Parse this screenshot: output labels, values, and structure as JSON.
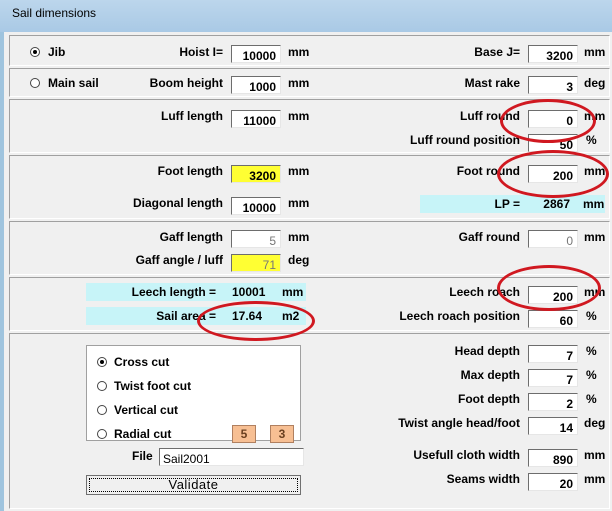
{
  "window": {
    "title": "Sail dimensions"
  },
  "sail_type": {
    "jib_label": "Jib",
    "main_label": "Main sail",
    "selected": "jib"
  },
  "fields": {
    "hoist": {
      "label": "Hoist I=",
      "value": "10000",
      "unit": "mm"
    },
    "base": {
      "label": "Base J=",
      "value": "3200",
      "unit": "mm"
    },
    "boom_height": {
      "label": "Boom height",
      "value": "1000",
      "unit": "mm"
    },
    "mast_rake": {
      "label": "Mast rake",
      "value": "3",
      "unit": "deg"
    },
    "luff_length": {
      "label": "Luff length",
      "value": "11000",
      "unit": "mm"
    },
    "luff_round": {
      "label": "Luff round",
      "value": "0",
      "unit": "mm"
    },
    "luff_round_position": {
      "label": "Luff round position",
      "value": "50",
      "unit": "%"
    },
    "foot_length": {
      "label": "Foot length",
      "value": "3200",
      "unit": "mm"
    },
    "foot_round": {
      "label": "Foot round",
      "value": "200",
      "unit": "mm"
    },
    "diagonal_length": {
      "label": "Diagonal length",
      "value": "10000",
      "unit": "mm"
    },
    "lp": {
      "label": "LP =",
      "value": "2867",
      "unit": "mm"
    },
    "gaff_length": {
      "label": "Gaff length",
      "value": "5",
      "unit": "mm"
    },
    "gaff_round": {
      "label": "Gaff round",
      "value": "0",
      "unit": "mm"
    },
    "gaff_angle": {
      "label": "Gaff angle / luff",
      "value": "71",
      "unit": "deg"
    },
    "leech_length": {
      "label": "Leech length =",
      "value": "10001",
      "unit": "mm"
    },
    "sail_area": {
      "label": "Sail area =",
      "value": "17.64",
      "unit": "m2"
    },
    "leech_roach": {
      "label": "Leech roach",
      "value": "200",
      "unit": "mm"
    },
    "leech_roach_position": {
      "label": "Leech roach position",
      "value": "60",
      "unit": "%"
    },
    "head_depth": {
      "label": "Head depth",
      "value": "7",
      "unit": "%"
    },
    "max_depth": {
      "label": "Max depth",
      "value": "7",
      "unit": "%"
    },
    "foot_depth": {
      "label": "Foot depth",
      "value": "2",
      "unit": "%"
    },
    "twist_angle": {
      "label": "Twist angle head/foot",
      "value": "14",
      "unit": "deg"
    },
    "usefull_cloth_width": {
      "label": "Usefull cloth width",
      "value": "890",
      "unit": "mm"
    },
    "seams_width": {
      "label": "Seams width",
      "value": "20",
      "unit": "mm"
    }
  },
  "cut": {
    "options": [
      "Cross cut",
      "Twist foot cut",
      "Vertical cut",
      "Radial cut"
    ],
    "selected": "Cross cut",
    "radial_a": "5",
    "radial_b": "3"
  },
  "file": {
    "label": "File",
    "value": "Sail2001"
  },
  "validate_label": "Validate",
  "colors": {
    "highlight_yellow": "#ffff33",
    "info_cyan": "#c7f4f8",
    "annotation_red": "#d01820"
  }
}
